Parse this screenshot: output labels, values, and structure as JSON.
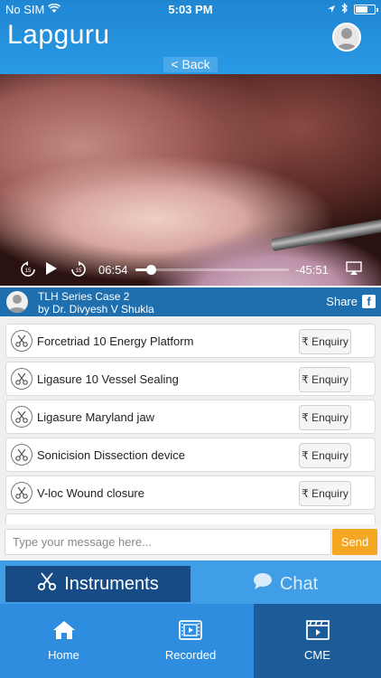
{
  "status": {
    "carrier": "No SIM",
    "time": "5:03 PM"
  },
  "app": {
    "logo": "Lapguru",
    "back_label": "< Back"
  },
  "video": {
    "current_time": "06:54",
    "remaining_time": "-45:51",
    "progress_fraction": 0.1
  },
  "case": {
    "title": "TLH Series Case 2",
    "author": "by Dr. Divyesh V Shukla",
    "share_label": "Share"
  },
  "instruments": {
    "items": [
      {
        "name": "Forcetriad 10 Energy Platform",
        "action": "₹ Enquiry"
      },
      {
        "name": "Ligasure 10 Vessel Sealing",
        "action": "₹ Enquiry"
      },
      {
        "name": "Ligasure Maryland jaw",
        "action": "₹ Enquiry"
      },
      {
        "name": "Sonicision Dissection device",
        "action": "₹ Enquiry"
      },
      {
        "name": "V-loc Wound closure",
        "action": "₹ Enquiry"
      }
    ]
  },
  "message": {
    "placeholder": "Type your message here...",
    "send_label": "Send"
  },
  "tabs": {
    "instruments_label": "Instruments",
    "chat_label": "Chat"
  },
  "nav": {
    "home_label": "Home",
    "recorded_label": "Recorded",
    "cme_label": "CME"
  },
  "colors": {
    "header": "#2a9ae6",
    "accent": "#f5a623",
    "active_tab": "#164b86",
    "active_nav": "#1c5c99"
  }
}
